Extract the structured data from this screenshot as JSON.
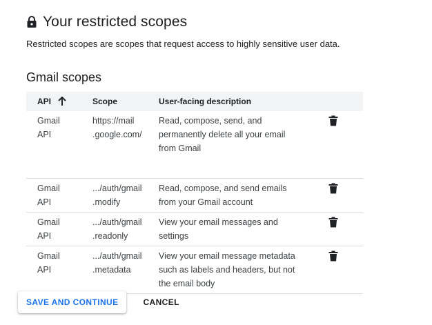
{
  "header": {
    "title": "Your restricted scopes",
    "lock_icon": "lock-icon",
    "subtitle": "Restricted scopes are scopes that request access to highly sensitive user data."
  },
  "section": {
    "title": "Gmail scopes"
  },
  "table": {
    "columns": {
      "api": "API",
      "scope": "Scope",
      "description": "User-facing description"
    },
    "sort_icon": "arrow-up-icon",
    "rows": [
      {
        "api_line1": "Gmail",
        "api_line2": "API",
        "scope_line1": "https://mail",
        "scope_line2": ".google.com/",
        "desc_line1": "Read, compose, send, and",
        "desc_line2": "permanently delete all your email",
        "desc_line3": "from Gmail",
        "action_icon": "trash-icon"
      },
      {
        "api_line1": "Gmail",
        "api_line2": "API",
        "scope_line1": ".../auth/gmail",
        "scope_line2": ".modify",
        "desc_line1": "Read, compose, and send emails",
        "desc_line2": "from your Gmail account",
        "action_icon": "trash-icon"
      },
      {
        "api_line1": "Gmail",
        "api_line2": "API",
        "scope_line1": ".../auth/gmail",
        "scope_line2": ".readonly",
        "desc_line1": "View your email messages and",
        "desc_line2": "settings",
        "action_icon": "trash-icon"
      },
      {
        "api_line1": "Gmail",
        "api_line2": "API",
        "scope_line1": ".../auth/gmail",
        "scope_line2": ".metadata",
        "desc_line1": "View your email message metadata",
        "desc_line2": "such as labels and headers, but not",
        "desc_line3": "the email body",
        "action_icon": "trash-icon"
      }
    ]
  },
  "actions": {
    "save_label": "SAVE AND CONTINUE",
    "cancel_label": "CANCEL"
  },
  "colors": {
    "accent": "#1a73e8",
    "header_bg": "#f1f3f4",
    "divider": "#dadce0",
    "text": "#202124"
  }
}
